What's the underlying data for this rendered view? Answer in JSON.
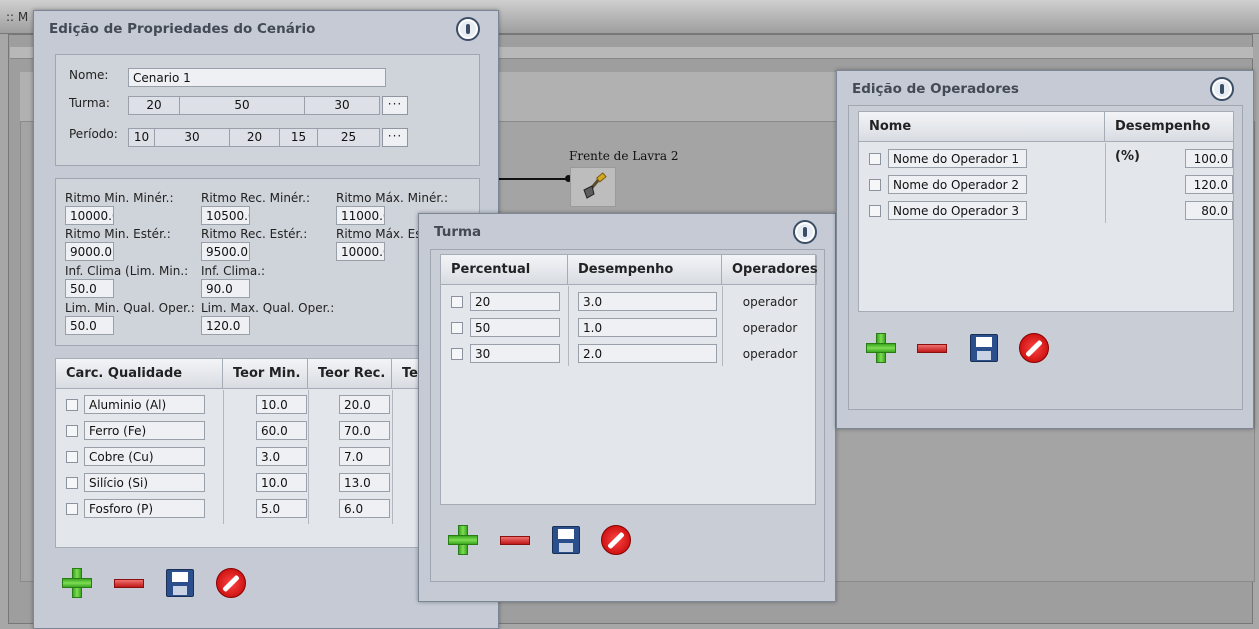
{
  "background": {
    "title": ":: M",
    "node": {
      "label": "Frente de Lavra 2",
      "icon": "shovel-icon"
    }
  },
  "scenario_dialog": {
    "title": "Edição de Propriedades do Cenário",
    "name_label": "Nome:",
    "name_value": "Cenario 1",
    "turma_label": "Turma:",
    "turma_segments": [
      "20",
      "50",
      "30"
    ],
    "periodo_label": "Período:",
    "periodo_segments": [
      "10",
      "30",
      "20",
      "15",
      "25"
    ],
    "ellipsis": "···",
    "rhythm_fields": [
      {
        "label": "Ritmo Min. Minér.:",
        "value": "10000.0"
      },
      {
        "label": "Ritmo Rec. Minér.:",
        "value": "10500.0"
      },
      {
        "label": "Ritmo Máx. Minér.:",
        "value": "11000.0"
      },
      {
        "label": "Ritmo Min. Estér.:",
        "value": "9000.0"
      },
      {
        "label": "Ritmo Rec. Estér.:",
        "value": "9500.0"
      },
      {
        "label": "Ritmo Máx. Estér.:",
        "value": "10000.0"
      },
      {
        "label": "Inf. Clima (Lim. Min.:",
        "value": "50.0"
      },
      {
        "label": "Inf. Clima.:",
        "value": "90.0"
      },
      {
        "label": "Lim. Min. Qual. Oper.:",
        "value": "50.0"
      },
      {
        "label": "Lim. Max. Qual. Oper.:",
        "value": "120.0"
      }
    ],
    "quality_grid": {
      "headers": [
        "Carc. Qualidade",
        "Teor Min.",
        "Teor Rec.",
        "Teor Máx."
      ],
      "rows": [
        {
          "name": "Aluminio (Al)",
          "min": "10.0",
          "rec": "20.0"
        },
        {
          "name": "Ferro (Fe)",
          "min": "60.0",
          "rec": "70.0"
        },
        {
          "name": "Cobre (Cu)",
          "min": "3.0",
          "rec": "7.0"
        },
        {
          "name": "Silício (Si)",
          "min": "10.0",
          "rec": "13.0"
        },
        {
          "name": "Fosforo (P)",
          "min": "5.0",
          "rec": "6.0"
        }
      ]
    }
  },
  "turma_dialog": {
    "title": "Turma",
    "headers": [
      "Percentual",
      "Desempenho",
      "Operadores"
    ],
    "rows": [
      {
        "percentual": "20",
        "desempenho": "3.0",
        "operadores": "operador"
      },
      {
        "percentual": "50",
        "desempenho": "1.0",
        "operadores": "operador"
      },
      {
        "percentual": "30",
        "desempenho": "2.0",
        "operadores": "operador"
      }
    ]
  },
  "operadores_dialog": {
    "title": "Edição de Operadores",
    "headers": [
      "Nome",
      "Desempenho (%)"
    ],
    "rows": [
      {
        "nome": "Nome do Operador 1",
        "desempenho": "100.0"
      },
      {
        "nome": "Nome do Operador 2",
        "desempenho": "120.0"
      },
      {
        "nome": "Nome do Operador 3",
        "desempenho": "80.0"
      }
    ]
  },
  "toolbar_icons": [
    "add-icon",
    "remove-icon",
    "save-icon",
    "cancel-icon"
  ]
}
